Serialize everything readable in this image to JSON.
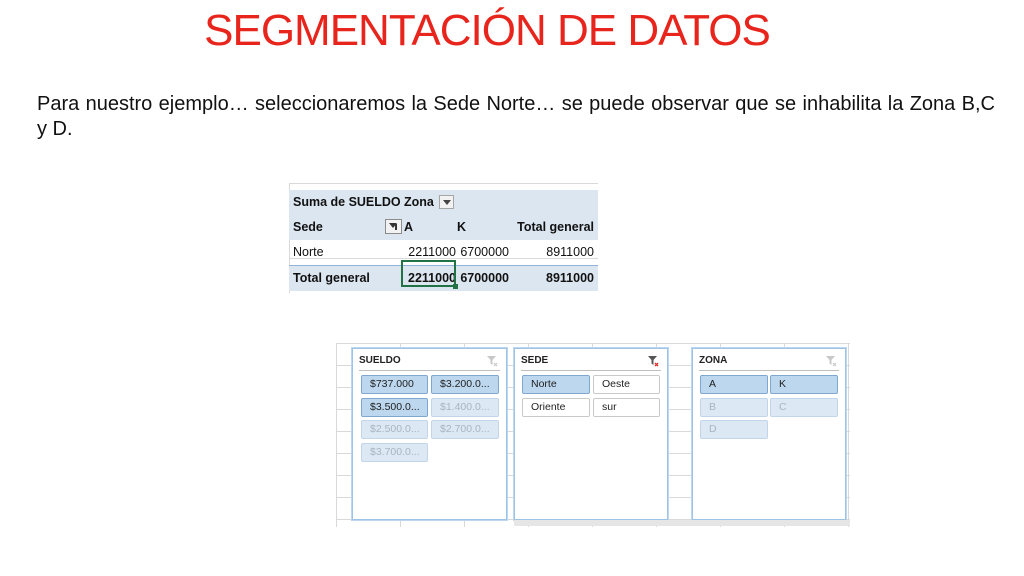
{
  "slide": {
    "title": "SEGMENTACIÓN DE DATOS",
    "paragraph": "Para nuestro ejemplo…  seleccionaremos la  Sede Norte… se puede observar que se inhabilita la Zona B,C y  D."
  },
  "pivot": {
    "value_field": "Suma de SUELDO",
    "column_field": "Zona",
    "row_field": "Sede",
    "columns": [
      "A",
      "K",
      "Total general"
    ],
    "rows": [
      {
        "label": "Norte",
        "values": [
          "2211000",
          "6700000",
          "8911000"
        ]
      }
    ],
    "total": {
      "label": "Total general",
      "values": [
        "2211000",
        "6700000",
        "8911000"
      ]
    }
  },
  "slicers": {
    "sueldo": {
      "title": "SUELDO",
      "items": [
        "$737.000",
        "$3.200.0...",
        "$3.500.0...",
        "$1.400.0...",
        "$2.500.0...",
        "$2.700.0...",
        "$3.700.0..."
      ]
    },
    "sede": {
      "title": "SEDE",
      "items": [
        "Norte",
        "Oeste",
        "Oriente",
        "sur"
      ]
    },
    "zona": {
      "title": "ZONA",
      "items": [
        "A",
        "K",
        "B",
        "C",
        "D"
      ]
    }
  },
  "colors": {
    "title": "#e8251c",
    "selected_item": "#bdd7ee",
    "disabled_item": "#dce9f5",
    "header_fill": "#dce6f1",
    "active_cell": "#217346"
  }
}
